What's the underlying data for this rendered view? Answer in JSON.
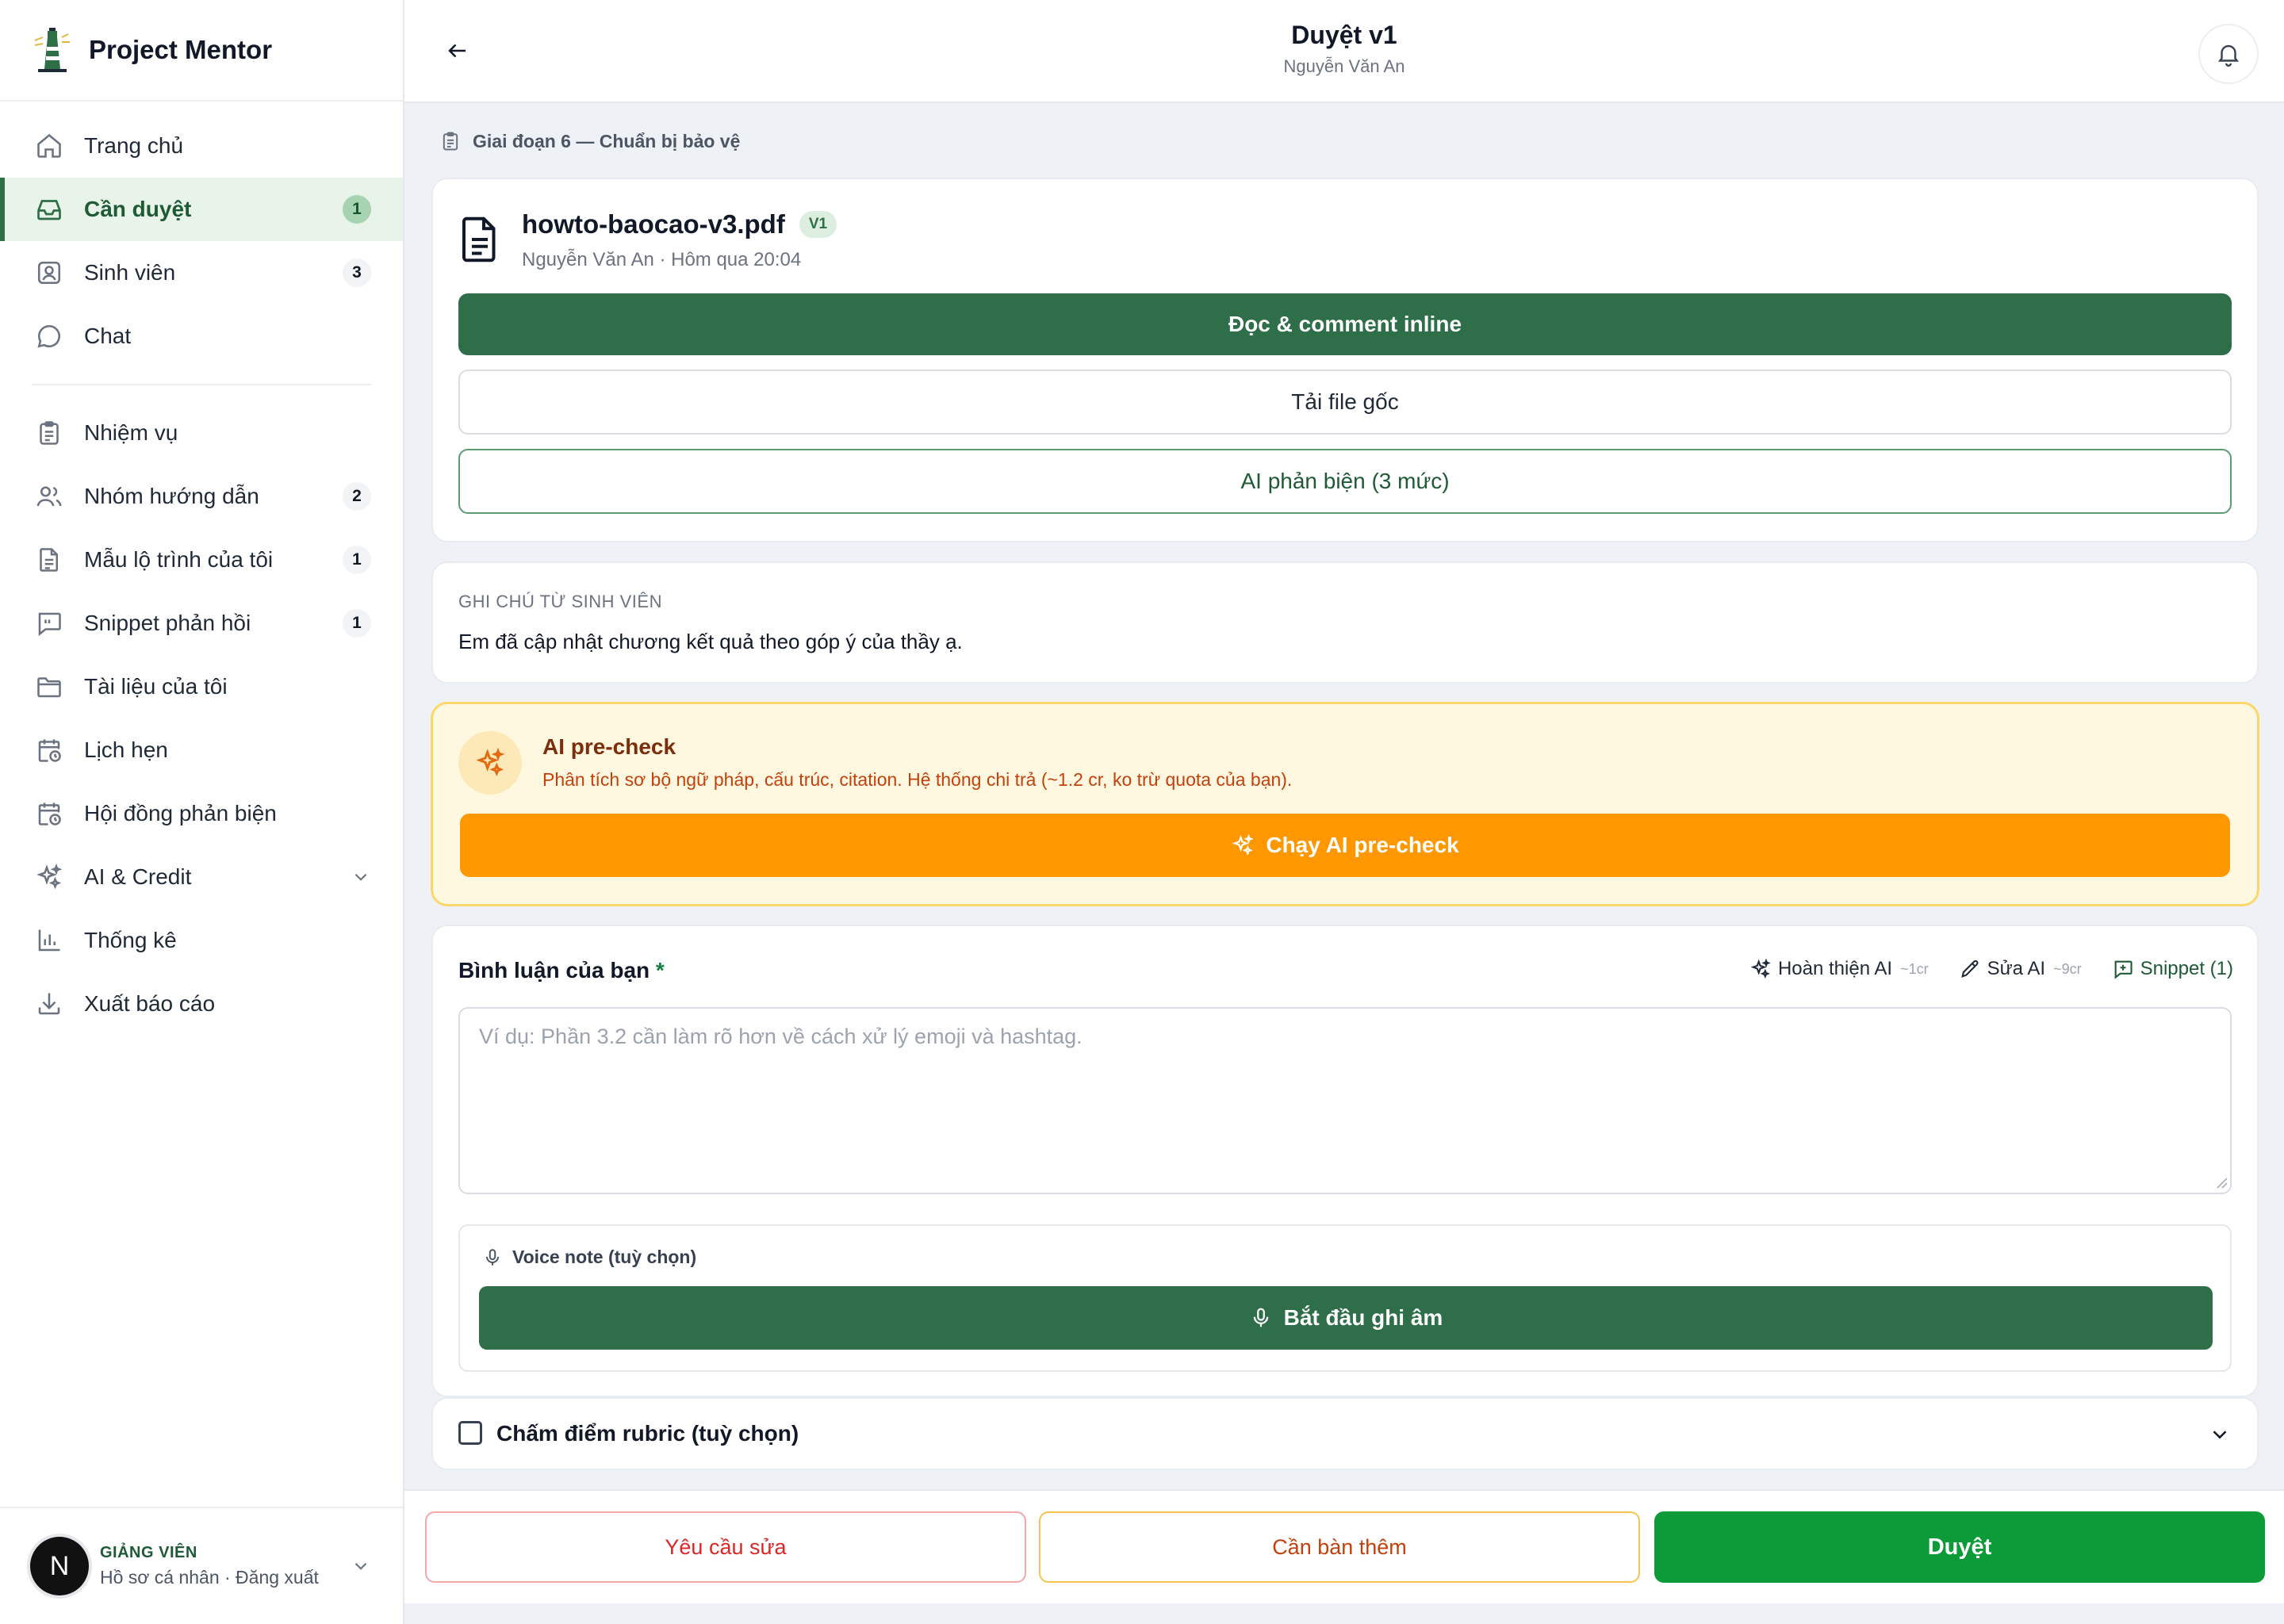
{
  "brand": {
    "name": "Project Mentor"
  },
  "sidebar": {
    "items": [
      {
        "label": "Trang chủ",
        "badge": ""
      },
      {
        "label": "Cần duyệt",
        "badge": "1"
      },
      {
        "label": "Sinh viên",
        "badge": "3"
      },
      {
        "label": "Chat",
        "badge": ""
      },
      {
        "label": "Nhiệm vụ",
        "badge": ""
      },
      {
        "label": "Nhóm hướng dẫn",
        "badge": "2"
      },
      {
        "label": "Mẫu lộ trình của tôi",
        "badge": "1"
      },
      {
        "label": "Snippet phản hồi",
        "badge": "1"
      },
      {
        "label": "Tài liệu của tôi",
        "badge": ""
      },
      {
        "label": "Lịch hẹn",
        "badge": ""
      },
      {
        "label": "Hội đồng phản biện",
        "badge": ""
      },
      {
        "label": "AI & Credit",
        "badge": ""
      },
      {
        "label": "Thống kê",
        "badge": ""
      },
      {
        "label": "Xuất báo cáo",
        "badge": ""
      }
    ],
    "active_index": 1
  },
  "user": {
    "initial": "N",
    "role": "GIẢNG VIÊN",
    "links": "Hồ sơ cá nhân · Đăng xuất"
  },
  "header": {
    "title": "Duyệt v1",
    "subtitle": "Nguyễn Văn An"
  },
  "breadcrumb": "Giai đoạn 6 — Chuẩn bị bảo vệ",
  "file": {
    "name": "howto-baocao-v3.pdf",
    "version": "V1",
    "meta": "Nguyễn Văn An · Hôm qua 20:04",
    "read_label": "Đọc & comment inline",
    "download_label": "Tải file gốc",
    "ai_review_label": "AI phản biện (3 mức)"
  },
  "note": {
    "label": "GHI CHÚ TỪ SINH VIÊN",
    "text": "Em đã cập nhật chương kết quả theo góp ý của thầy ạ."
  },
  "ai_precheck": {
    "title": "AI pre-check",
    "desc": "Phân tích sơ bộ ngữ pháp, cấu trúc, citation. Hệ thống chi trả (~1.2 cr, ko trừ quota của bạn).",
    "button": "Chạy AI pre-check"
  },
  "comment": {
    "label": "Bình luận của bạn",
    "required_mark": "*",
    "tools": {
      "polish_label": "Hoàn thiện AI",
      "polish_cost": "~1cr",
      "fix_label": "Sửa AI",
      "fix_cost": "~9cr",
      "snippet_label": "Snippet (1)"
    },
    "placeholder": "Ví dụ: Phần 3.2 cần làm rõ hơn về cách xử lý emoji và hashtag.",
    "voice_label": "Voice note (tuỳ chọn)",
    "record_label": "Bắt đầu ghi âm"
  },
  "rubric": {
    "label": "Chấm điểm rubric (tuỳ chọn)",
    "checked": false
  },
  "footer": {
    "request_changes": "Yêu cầu sửa",
    "need_discuss": "Cần bàn thêm",
    "approve": "Duyệt"
  },
  "colors": {
    "primary": "#2e6f4a",
    "approve": "#0c9b38",
    "orange": "#ff9800",
    "danger": "#dc2626",
    "amber_border": "#fbd86a"
  }
}
